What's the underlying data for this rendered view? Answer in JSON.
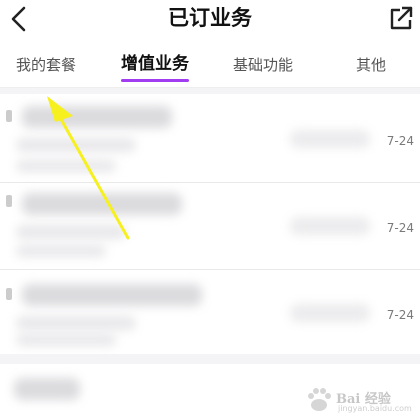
{
  "header": {
    "title": "已订业务",
    "back_icon": "chevron-left-icon",
    "share_icon": "external-share-icon"
  },
  "tabs": [
    {
      "label": "我的套餐",
      "active": false
    },
    {
      "label": "增值业务",
      "active": true
    },
    {
      "label": "基础功能",
      "active": false
    },
    {
      "label": "其他",
      "active": false
    }
  ],
  "accent_color": "#a23cf0",
  "annotation_color": "#f6f01e",
  "list": {
    "items": [
      {
        "date_suffix": "7-24",
        "edge_char": ""
      },
      {
        "date_suffix": "7-24",
        "edge_char": ""
      },
      {
        "date_suffix": "7-24",
        "edge_char": ""
      }
    ]
  },
  "watermark": {
    "text": "Bai 经验",
    "sub": "jingyan.baidu.com"
  }
}
